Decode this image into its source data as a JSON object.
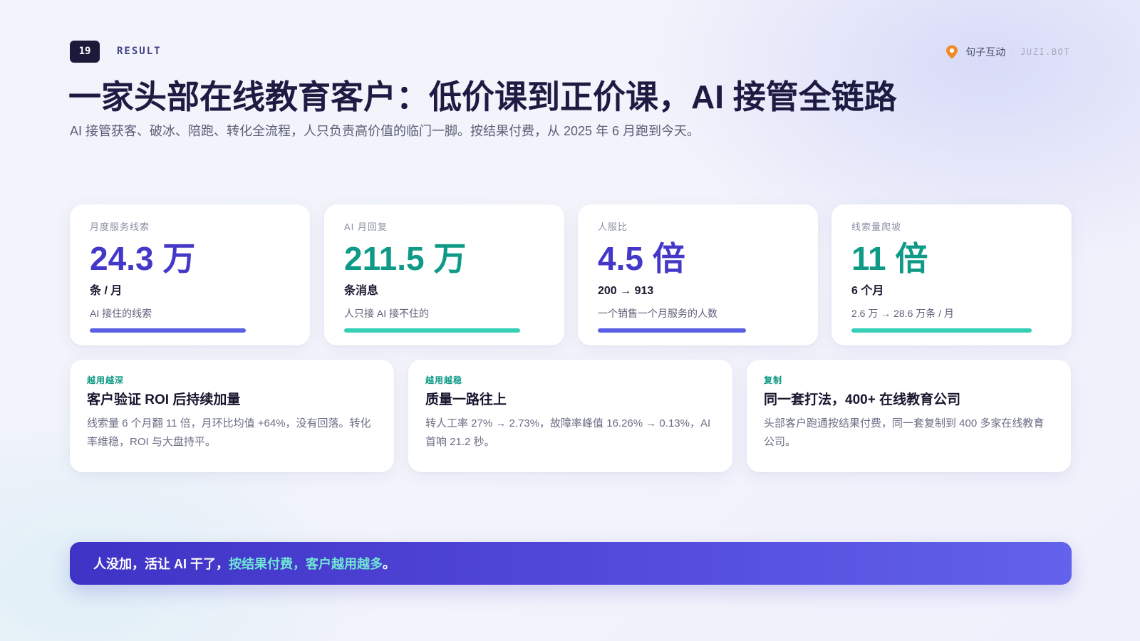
{
  "header": {
    "page_number": "19",
    "section_label": "RESULT",
    "brand_name": "句子互动",
    "brand_domain": "JUZI.BOT"
  },
  "title": "一家头部在线教育客户：低价课到正价课，AI 接管全链路",
  "subtitle": "AI 接管获客、破冰、陪跑、转化全流程，人只负责高价值的临门一脚。按结果付费，从 2025 年 6 月跑到今天。",
  "stats": [
    {
      "label": "月度服务线索",
      "value": "24.3 万",
      "unit": "条 / 月",
      "desc": "AI 接住的线索",
      "bar_fraction": 0.78,
      "accent": "#4438c8"
    },
    {
      "label": "AI 月回复",
      "value": "211.5 万",
      "unit": "条消息",
      "desc": "人只接 AI 接不住的",
      "bar_fraction": 0.88,
      "accent": "#0e9a86"
    },
    {
      "label": "人服比",
      "value": "4.5 倍",
      "unit": "200 → 913",
      "desc": "一个销售一个月服务的人数",
      "bar_fraction": 0.74,
      "accent": "#4438c8"
    },
    {
      "label": "线索量爬坡",
      "value": "11 倍",
      "unit": "6 个月",
      "desc": "2.6 万 → 28.6 万条 / 月",
      "bar_fraction": 0.9,
      "accent": "#0e9a86"
    }
  ],
  "insights": [
    {
      "tag": "越用越深",
      "title": "客户验证 ROI 后持续加量",
      "text": "线索量 6 个月翻 11 倍，月环比均值 +64%，没有回落。转化率维稳，ROI 与大盘持平。"
    },
    {
      "tag": "越用越稳",
      "title": "质量一路往上",
      "text": "转人工率 27% → 2.73%，故障率峰值 16.26% → 0.13%，AI 首响 21.2 秒。"
    },
    {
      "tag": "复制",
      "title": "同一套打法，400+ 在线教育公司",
      "text": "头部客户跑通按结果付费，同一套复制到 400 多家在线教育公司。"
    }
  ],
  "footer": {
    "lead": "人没加，活让 AI 干了，",
    "highlight": "按结果付费，客户越用越多",
    "end": "。"
  },
  "colors": {
    "indigo": "#4438c8",
    "teal": "#0e9a86",
    "banner": "#4f45d6",
    "brand_pin": "#f08a24"
  }
}
